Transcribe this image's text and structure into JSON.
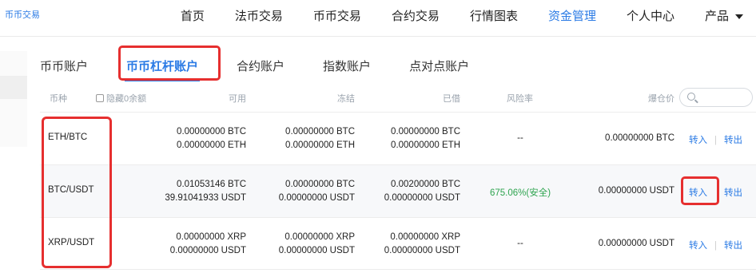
{
  "brand": "币币交易",
  "nav": {
    "items": [
      "首页",
      "法币交易",
      "币币交易",
      "合约交易",
      "行情图表",
      "资金管理",
      "个人中心",
      "产品"
    ],
    "active_index": 5
  },
  "tabs": {
    "items": [
      "币币账户",
      "币币杠杆账户",
      "合约账户",
      "指数账户",
      "点对点账户"
    ],
    "active_index": 1
  },
  "table": {
    "headers": {
      "coin": "币种",
      "hide_zero": "隐藏0余额",
      "available": "可用",
      "frozen": "冻结",
      "borrowed": "已借",
      "risk": "风险率",
      "liquidation": "爆仓价"
    },
    "rows": [
      {
        "pair": "ETH/BTC",
        "available": [
          "0.00000000 BTC",
          "0.00000000 ETH"
        ],
        "frozen": [
          "0.00000000 BTC",
          "0.00000000 ETH"
        ],
        "borrowed": [
          "0.00000000 BTC",
          "0.00000000 ETH"
        ],
        "risk": "--",
        "liquidation": "0.00000000 BTC",
        "transfer_in": "转入",
        "transfer_out": "转出"
      },
      {
        "pair": "BTC/USDT",
        "available": [
          "0.01053146 BTC",
          "39.91041933 USDT"
        ],
        "frozen": [
          "0.00000000 BTC",
          "0.00000000 USDT"
        ],
        "borrowed": [
          "0.00200000 BTC",
          "0.00000000 USDT"
        ],
        "risk": "675.06%(安全)",
        "liquidation": "0.00000000 USDT",
        "transfer_in": "转入",
        "transfer_out": "转出"
      },
      {
        "pair": "XRP/USDT",
        "available": [
          "0.00000000 XRP",
          "0.00000000 USDT"
        ],
        "frozen": [
          "0.00000000 XRP",
          "0.00000000 USDT"
        ],
        "borrowed": [
          "0.00000000 XRP",
          "0.00000000 USDT"
        ],
        "risk": "--",
        "liquidation": "0.00000000 USDT",
        "transfer_in": "转入",
        "transfer_out": "转出"
      }
    ]
  },
  "colors": {
    "accent": "#2b7be5",
    "highlight_box": "#e62f2f",
    "safe": "#2ea44f"
  }
}
